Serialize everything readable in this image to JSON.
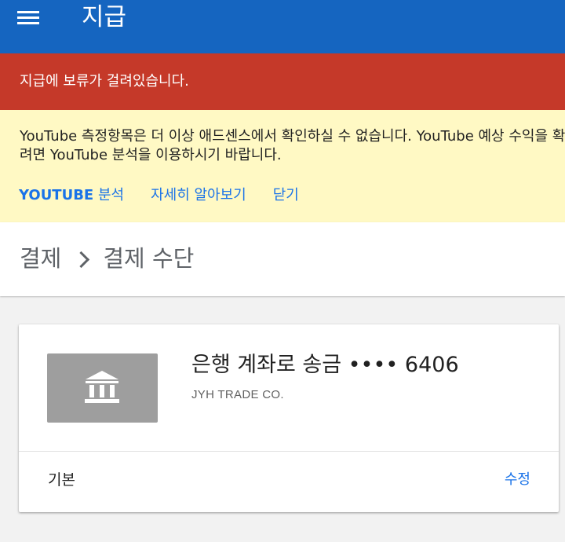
{
  "appbar": {
    "title": "지급",
    "menu_icon": "menu-icon",
    "color": "#1565c0"
  },
  "hold_banner": {
    "text": "지급에 보류가 걸려있습니다.",
    "color": "#c53929"
  },
  "info_banner": {
    "message": "YouTube 측정항목은 더 이상 애드센스에서 확인하실 수 없습니다. YouTube 예상 수익을 확인하려면 YouTube 분석을 이용하시기 바랍니다.",
    "actions": {
      "analytics_strong": "YOUTUBE",
      "analytics_rest": " 분석",
      "learn_more": "자세히 알아보기",
      "close": "닫기"
    },
    "color": "#fff9c4",
    "link_color": "#1a73e8"
  },
  "breadcrumb": {
    "parent": "결제",
    "separator_icon": "chevron-right-icon",
    "current": "결제 수단"
  },
  "payment_method": {
    "icon": "bank-icon",
    "title": "은행 계좌로 송금 •••• 6406",
    "holder": "JYH TRADE CO.",
    "status": "기본",
    "edit_label": "수정"
  }
}
